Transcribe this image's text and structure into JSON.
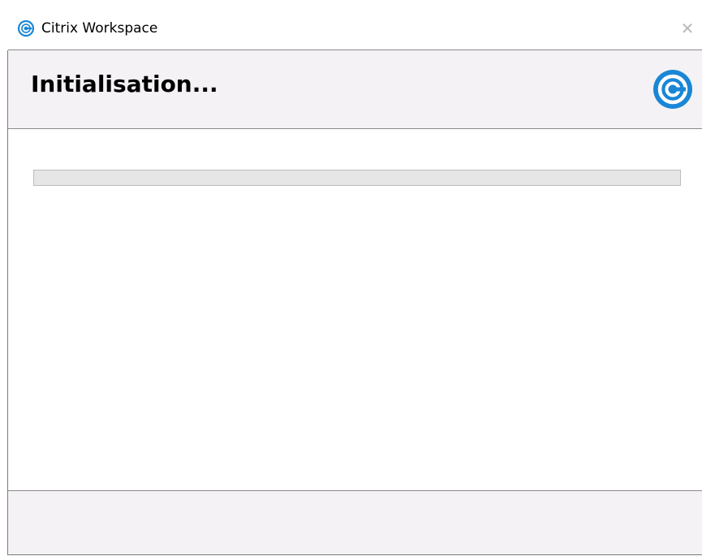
{
  "window": {
    "title": "Citrix Workspace",
    "close_glyph": "✕",
    "title_icon": "citrix-logo-icon"
  },
  "header": {
    "heading": "Initialisation...",
    "logo_icon": "citrix-logo-icon"
  },
  "progress": {
    "value_fraction": 0.0
  },
  "colors": {
    "citrix_blue": "#1a86d6",
    "header_bg": "#f5f2f5",
    "progress_track": "#e6e6e6"
  }
}
